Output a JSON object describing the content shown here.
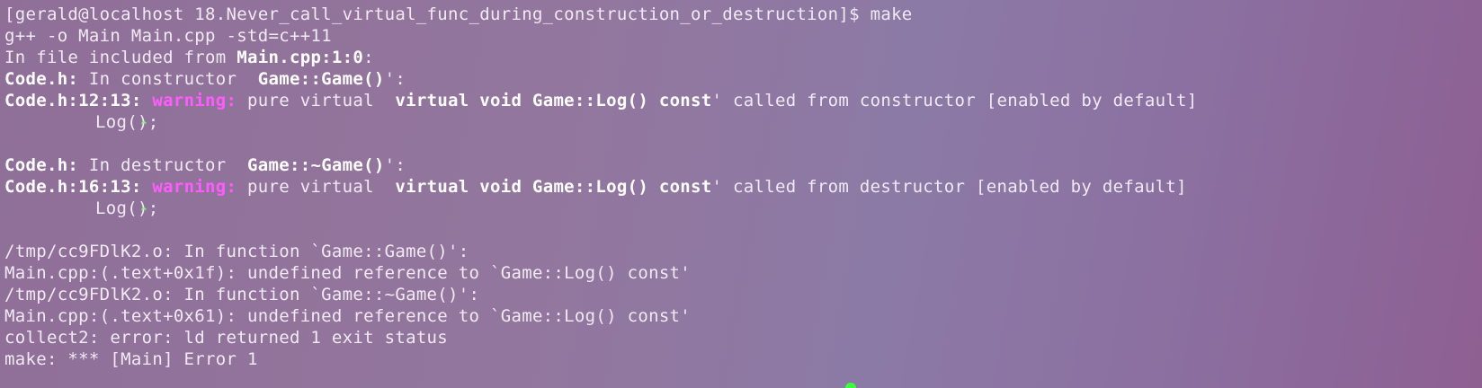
{
  "terminal": {
    "lines": [
      {
        "text": "[gerald@localhost 18.Never_call_virtual_func_during_construction_or_destruction]$ make"
      },
      {
        "text": "g++ -o Main Main.cpp -std=c++11"
      },
      {
        "prefix": "In file included from ",
        "bold": "Main.cpp:1:0",
        "suffix": ":"
      },
      {
        "bold": "Code.h:",
        "mid": " In constructor  ",
        "bold2": "Game::Game()",
        "suffix": "':"
      },
      {
        "bold": "Code.h:12:13:",
        "warn": " warning:",
        "mid": " pure virtual  ",
        "bold2": "virtual void Game::Log() const",
        "suffix": "' called from constructor [enabled by default]"
      },
      {
        "text": "Log();"
      },
      {
        "text": ""
      },
      {
        "bold": "Code.h:",
        "mid": " In destructor  ",
        "bold2": "Game::~Game()",
        "suffix": "':"
      },
      {
        "bold": "Code.h:16:13:",
        "warn": " warning:",
        "mid": " pure virtual  ",
        "bold2": "virtual void Game::Log() const",
        "suffix": "' called from destructor [enabled by default]"
      },
      {
        "text": "Log();"
      },
      {
        "text": ""
      },
      {
        "text": "/tmp/cc9FDlK2.o: In function `Game::Game()':"
      },
      {
        "text": "Main.cpp:(.text+0x1f): undefined reference to `Game::Log() const'"
      },
      {
        "text": "/tmp/cc9FDlK2.o: In function `Game::~Game()':"
      },
      {
        "text": "Main.cpp:(.text+0x61): undefined reference to `Game::Log() const'"
      },
      {
        "text": "collect2: error: ld returned 1 exit status"
      },
      {
        "text": "make: *** [Main] Error 1"
      }
    ]
  },
  "colors": {
    "warning": "#ff5cff",
    "caret": "#7dff7d",
    "cursor": "#3cff3c",
    "text": "#f1eaf4",
    "background": "#93769d"
  }
}
